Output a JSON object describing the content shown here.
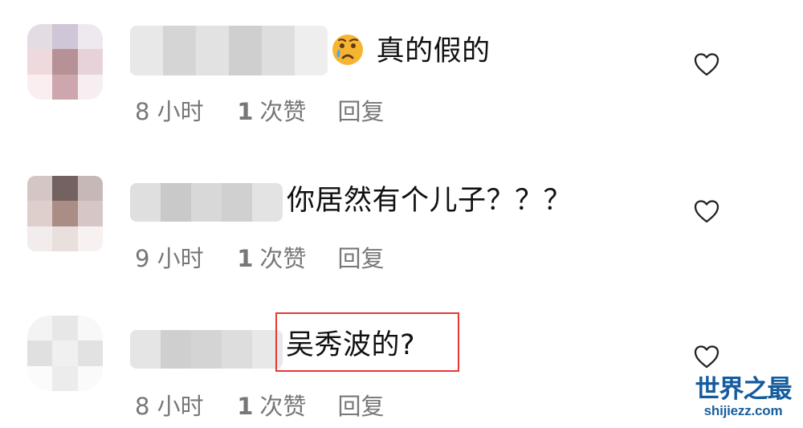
{
  "comments": [
    {
      "text": "真的假的",
      "time": "8 小时",
      "like_count": "1",
      "like_label": "次赞",
      "reply": "回复"
    },
    {
      "text": "你居然有个儿子？？？",
      "time": "9 小时",
      "like_count": "1",
      "like_label": "次赞",
      "reply": "回复"
    },
    {
      "text": "吴秀波的?",
      "time": "8 小时",
      "like_count": "1",
      "like_label": "次赞",
      "reply": "回复"
    }
  ],
  "icons": {
    "heart": "heart-icon",
    "emoji": "crying-face-icon"
  },
  "colors": {
    "highlight": "#e53935",
    "watermark": "#155c9d",
    "meta": "#777777",
    "text": "#111111"
  },
  "watermark": {
    "cn": "世界之最",
    "url": "shijiezz.com"
  }
}
